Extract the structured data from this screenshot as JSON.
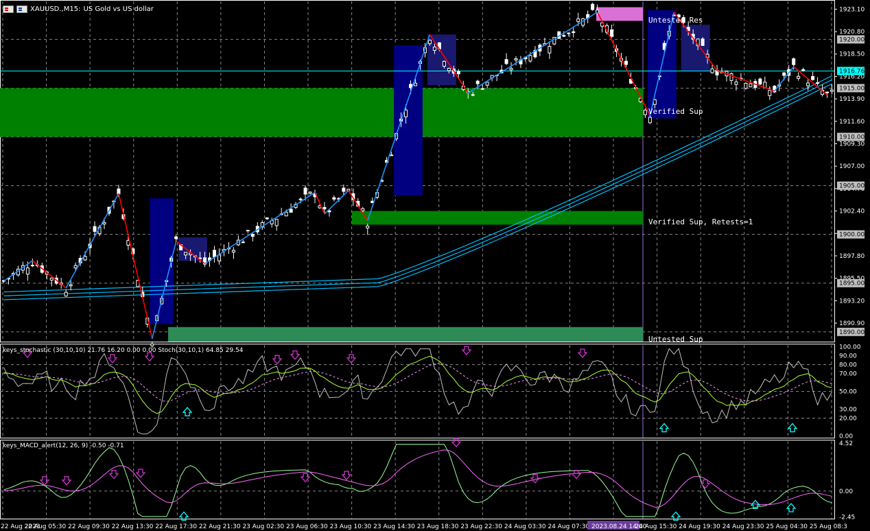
{
  "header": {
    "symbol": "XAUUSD.,M15:",
    "description": "US Gold vs US dollar"
  },
  "zone_labels": {
    "untested_res": "Untested Res",
    "verified_sup": "Verified Sup",
    "verified_sup_retests": "Verified Sup, Retests=1",
    "untested_sup": "Untested Sup"
  },
  "indicators": {
    "stoch_label": "keys_stochastic (30,10,10) 21.76 16.20 0.00 0.00 Stoch(30,10,1) 64.85 29.54",
    "macd_label": "keys_MACD_alert(12, 26, 9) -0.50 -0.71"
  },
  "colors": {
    "background": "#000000",
    "bull_candle": "#ffffff",
    "bear_candle": "#ffffff",
    "zigzag_up": "#1e90ff",
    "zigzag_down": "#ff0000",
    "support_zone": "#008000",
    "untested_sup_zone": "#2e8b57",
    "resistance_zone": "#da70d6",
    "moving_average": "#00bfff",
    "bid_line": "#00ffff",
    "sell_arrow": "#cc33cc",
    "buy_arrow": "#00ffff",
    "stoch_main": "#c0c0c0",
    "stoch_signal": "#ff99ff",
    "macd_main": "#99ff99",
    "macd_signal": "#ff66ff"
  },
  "chart_data": [
    {
      "type": "candlestick",
      "ylim": [
        1889.0,
        1923.9
      ],
      "price_ticks": [
        "1923.10",
        "1920.80",
        "1918.50",
        "1916.20",
        "1913.90",
        "1911.60",
        "1909.30",
        "1907.00",
        "1904.70",
        "1902.40",
        "1900.10",
        "1897.80",
        "1895.50",
        "1893.20",
        "1890.90"
      ],
      "highlighted_levels": [
        "1920.00",
        "1915.00",
        "1910.00",
        "1905.00",
        "1900.00",
        "1895.00",
        "1890.00"
      ],
      "current_price": "1916.76",
      "current_price_value": 1916.76,
      "x_ticks": [
        "22 Aug 2023",
        "22 Aug 05:30",
        "22 Aug 09:30",
        "22 Aug 13:30",
        "22 Aug 17:30",
        "22 Aug 21:30",
        "23 Aug 02:30",
        "23 Aug 06:30",
        "23 Aug 10:30",
        "23 Aug 14:30",
        "23 Aug 18:30",
        "23 Aug 22:30",
        "24 Aug 03:30",
        "24 Aug 07:30",
        "2023.08.24 14:00",
        "24 Aug 15:30",
        "24 Aug 19:30",
        "24 Aug 23:30",
        "25 Aug 04:30",
        "25 Aug 08:3"
      ],
      "cursor_time": "2023.08.24 14:00",
      "zones": [
        {
          "label_key": "verified_sup",
          "type": "support",
          "from": 1910.0,
          "to": 1915.0
        },
        {
          "label_key": "verified_sup_retests",
          "type": "support",
          "from": 1901.0,
          "to": 1902.4
        },
        {
          "label_key": "untested_sup",
          "type": "untested_support",
          "from": 1889.0,
          "to": 1890.5
        },
        {
          "label_key": "untested_res",
          "type": "resistance",
          "from": 1921.9,
          "to": 1923.3
        }
      ],
      "zigzag": [
        [
          0,
          1895.2
        ],
        [
          6,
          1897.3
        ],
        [
          13,
          1894.5
        ],
        [
          24,
          1904.2
        ],
        [
          31,
          1889.3
        ],
        [
          36,
          1899.3
        ],
        [
          42,
          1897.0
        ],
        [
          65,
          1904.3
        ],
        [
          67,
          1902.1
        ],
        [
          72,
          1904.5
        ],
        [
          76,
          1901.4
        ],
        [
          89,
          1920.5
        ],
        [
          97,
          1914.5
        ],
        [
          124,
          1922.8
        ],
        [
          135,
          1912.2
        ],
        [
          140,
          1922.8
        ],
        [
          149,
          1916.8
        ],
        [
          161,
          1914.7
        ],
        [
          165,
          1917.2
        ],
        [
          172,
          1914.3
        ]
      ],
      "bars_count": 174
    },
    {
      "type": "line",
      "name_key": "stoch_label",
      "ylim": [
        -2,
        102
      ],
      "y_ticks": [
        "100.00",
        "90.00",
        "80.00",
        "70.00",
        "50.00",
        "30.00",
        "20.00",
        "0.00"
      ],
      "last_values": [
        21.76,
        16.2,
        64.85,
        29.54
      ]
    },
    {
      "type": "line",
      "name_key": "macd_label",
      "ylim": [
        -2.6,
        4.7
      ],
      "y_ticks": [
        "4.52",
        "0.00",
        "-2.45"
      ],
      "last_values": [
        -0.5,
        -0.71
      ]
    }
  ]
}
